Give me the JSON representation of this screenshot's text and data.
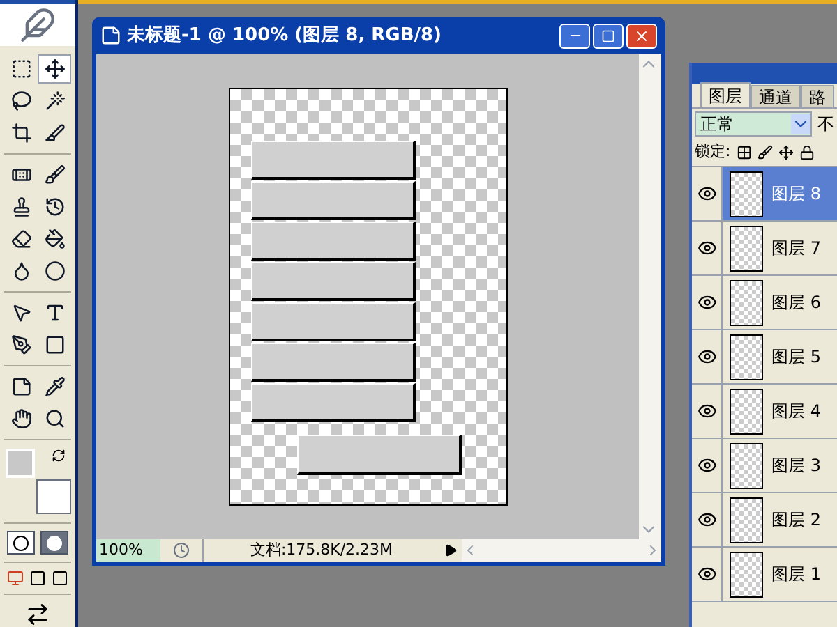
{
  "document": {
    "title": "未标题-1 @ 100% (图层 8, RGB/8)",
    "zoom": "100%",
    "doc_info": "文档:175.8K/2.23M"
  },
  "layers_panel": {
    "tabs": [
      {
        "label": "图层",
        "selected": true
      },
      {
        "label": "通道",
        "selected": false
      },
      {
        "label": "路",
        "selected": false
      }
    ],
    "blend_mode": "正常",
    "opacity_label": "不",
    "lock_label": "锁定:",
    "layers": [
      {
        "name": "图层 8",
        "selected": true,
        "visible": true
      },
      {
        "name": "图层 7",
        "selected": false,
        "visible": true
      },
      {
        "name": "图层 6",
        "selected": false,
        "visible": true
      },
      {
        "name": "图层 5",
        "selected": false,
        "visible": true
      },
      {
        "name": "图层 4",
        "selected": false,
        "visible": true
      },
      {
        "name": "图层 3",
        "selected": false,
        "visible": true
      },
      {
        "name": "图层 2",
        "selected": false,
        "visible": true
      },
      {
        "name": "图层 1",
        "selected": false,
        "visible": true
      }
    ]
  }
}
